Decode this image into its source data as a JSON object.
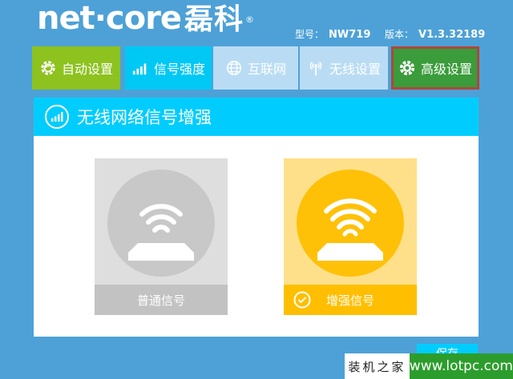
{
  "header": {
    "logo_text": "net·core",
    "logo_cn": "磊科",
    "logo_reg": "®",
    "model_label": "型号：",
    "model_value": "NW719",
    "version_label": "版本：",
    "version_value": "V1.3.32189"
  },
  "nav": {
    "auto": "自动设置",
    "signal": "信号强度",
    "internet": "互联网",
    "wireless": "无线设置",
    "advanced": "高级设置"
  },
  "panel": {
    "title": "无线网络信号增强"
  },
  "options": {
    "normal": "普通信号",
    "boost": "增强信号",
    "selected": "boost"
  },
  "save_label": "保存",
  "watermark": {
    "cn": "装机之家",
    "url": "www.lotpc.com"
  },
  "colors": {
    "background": "#4da1d7",
    "nav_auto": "#8dc21f",
    "nav_active": "#00c8f5",
    "nav_inactive": "#b9dcf4",
    "nav_advanced": "#3a9c3a",
    "panel_header": "#00cdfd",
    "boost_accent": "#ffc107",
    "normal_gray": "#c8c8c8"
  }
}
